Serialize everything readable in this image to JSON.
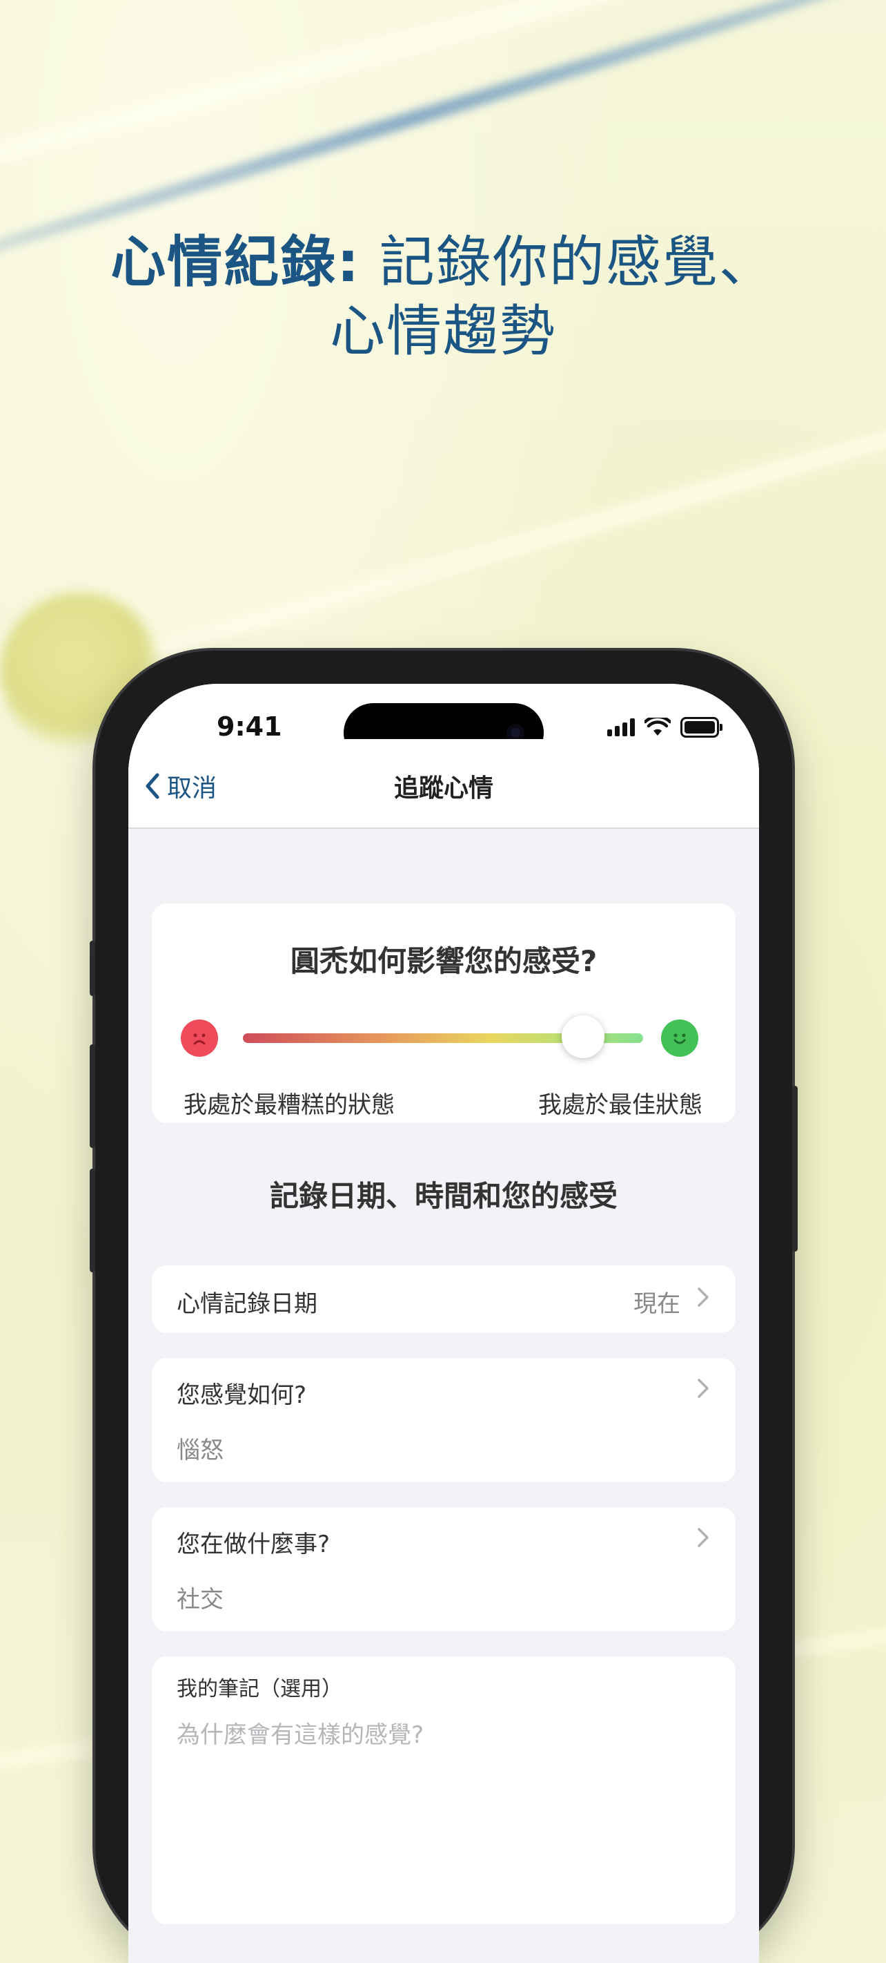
{
  "headline": {
    "bold": "心情紀錄:",
    "line1_rest": " 記錄你的感覺、",
    "line2": "心情趨勢"
  },
  "status_bar": {
    "time": "9:41"
  },
  "nav": {
    "back_label": "取消",
    "title": "追蹤心情"
  },
  "mood_card": {
    "question": "圓禿如何影響您的感受?",
    "low_label": "我處於最糟糕的狀態",
    "high_label": "我處於最佳狀態",
    "level": 0.85
  },
  "section_title": "記錄日期、時間和您的感受",
  "date_row": {
    "label": "心情記錄日期",
    "value": "現在"
  },
  "feeling_row": {
    "label": "您感覺如何?",
    "value": "惱怒"
  },
  "activity_row": {
    "label": "您在做什麼事?",
    "value": "社交"
  },
  "notes": {
    "label": "我的筆記（選用）",
    "placeholder": "為什麼會有這樣的感覺?"
  },
  "colors": {
    "brand": "#1b5584",
    "sad": "#ef4b5a",
    "happy": "#43c056"
  }
}
